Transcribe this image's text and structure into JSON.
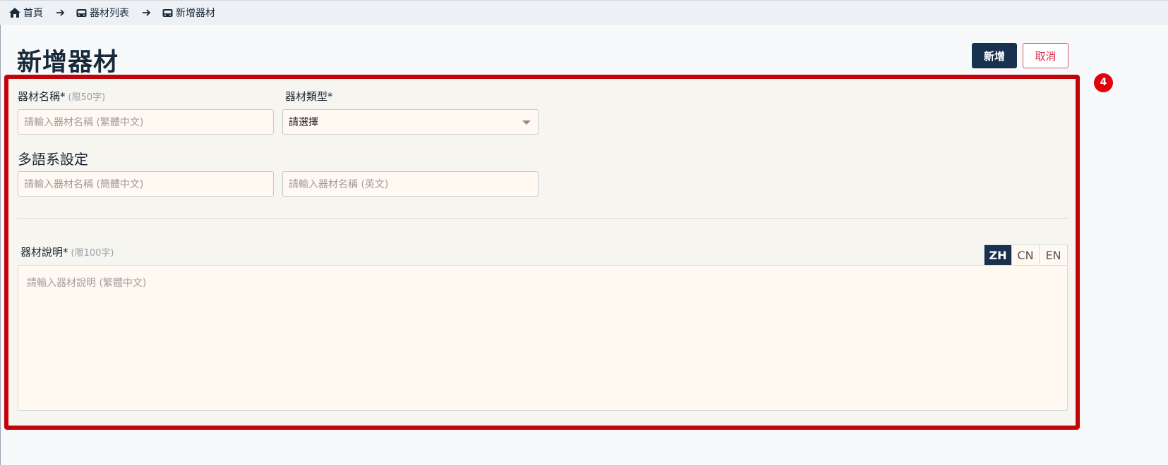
{
  "breadcrumb": {
    "items": [
      {
        "label": "首頁",
        "icon": "home-icon"
      },
      {
        "label": "器材列表",
        "icon": "equipment-icon"
      },
      {
        "label": "新增器材",
        "icon": "equipment-icon"
      }
    ]
  },
  "page": {
    "title": "新增器材",
    "add_button": "新增",
    "cancel_button": "取消"
  },
  "annotation": {
    "badge": "4",
    "frame_color": "#c2040a",
    "badge_color": "#e1010a"
  },
  "form": {
    "name_label": "器材名稱*",
    "name_hint": "(限50字)",
    "name_placeholder": "請輸入器材名稱 (繁體中文)",
    "type_label": "器材類型*",
    "type_value": "請選擇",
    "i18n_section": "多語系設定",
    "name_cn_placeholder": "請輸入器材名稱 (簡體中文)",
    "name_en_placeholder": "請輸入器材名稱 (英文)",
    "desc_label": "器材說明*",
    "desc_hint": "(限100字)",
    "desc_placeholder": "請輸入器材說明 (繁體中文)",
    "lang_tabs": [
      "ZH",
      "CN",
      "EN"
    ],
    "active_lang": "ZH"
  },
  "colors": {
    "primary": "#17314f",
    "cancel": "#d0344e",
    "field_bg": "#fff9f2"
  }
}
